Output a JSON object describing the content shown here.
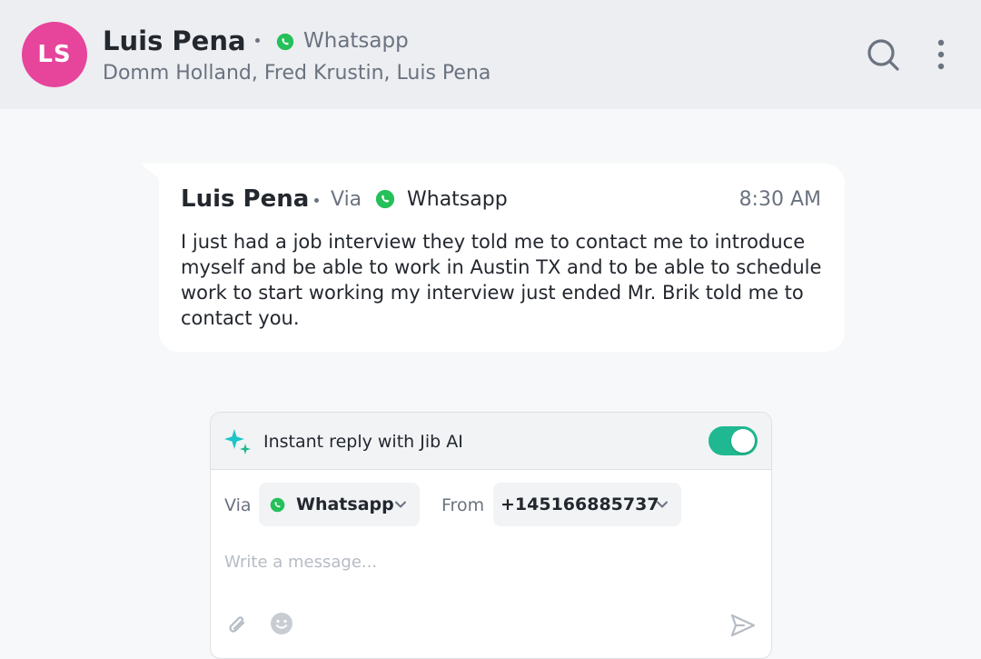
{
  "header": {
    "avatar_initials": "LS",
    "avatar_color": "#e7449c",
    "contact_name": "Luis Pena",
    "channel": "Whatsapp",
    "participants": "Domm Holland, Fred Krustin, Luis Pena",
    "icons": [
      "whatsapp-icon",
      "search-icon",
      "more-vertical-icon"
    ]
  },
  "message": {
    "sender": "Luis Pena",
    "via_label": "Via",
    "channel": "Whatsapp",
    "time": "8:30 AM",
    "text": "I just had a job interview they told me to contact me to introduce myself and be able to work in Austin TX and to be able to schedule work to start working my interview just ended Mr. Brik told me to contact you."
  },
  "composer": {
    "ai_label": "Instant reply with Jib AI",
    "ai_enabled": true,
    "toggle_color": "#1fb890",
    "via_label": "Via",
    "via_value": "Whatsapp",
    "from_label": "From",
    "from_value": "+145166885737",
    "message_placeholder": "Write a message...",
    "icons": [
      "sparkle-icon",
      "paperclip-icon",
      "emoji-icon",
      "send-icon",
      "chevron-down-icon"
    ]
  },
  "colors": {
    "whatsapp_green": "#25c05a",
    "ai_accent": "#1cc6c6"
  }
}
